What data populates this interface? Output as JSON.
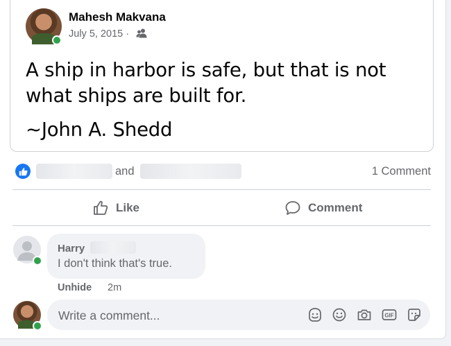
{
  "post": {
    "author_name": "Mahesh Makvana",
    "date": "July 5, 2015 ·",
    "audience_icon": "friends-icon",
    "quote_line": "A ship in harbor is safe, but that is not what ships are built for.",
    "quote_author": "~John A. Shedd"
  },
  "reactions": {
    "icon": "like-icon",
    "connector": "and",
    "comment_count": "1 Comment"
  },
  "actions": {
    "like_label": "Like",
    "comment_label": "Comment"
  },
  "comment": {
    "author": "Harry",
    "text": "I don't think that's true.",
    "unhide_label": "Unhide",
    "time": "2m"
  },
  "composer": {
    "placeholder": "Write a comment...",
    "icons": [
      "avatar-sticker-icon",
      "emoji-icon",
      "camera-icon",
      "gif-icon",
      "sticker-icon"
    ]
  },
  "colors": {
    "accent": "#1877f2",
    "online": "#31a24c",
    "secondary_text": "#65676b"
  }
}
